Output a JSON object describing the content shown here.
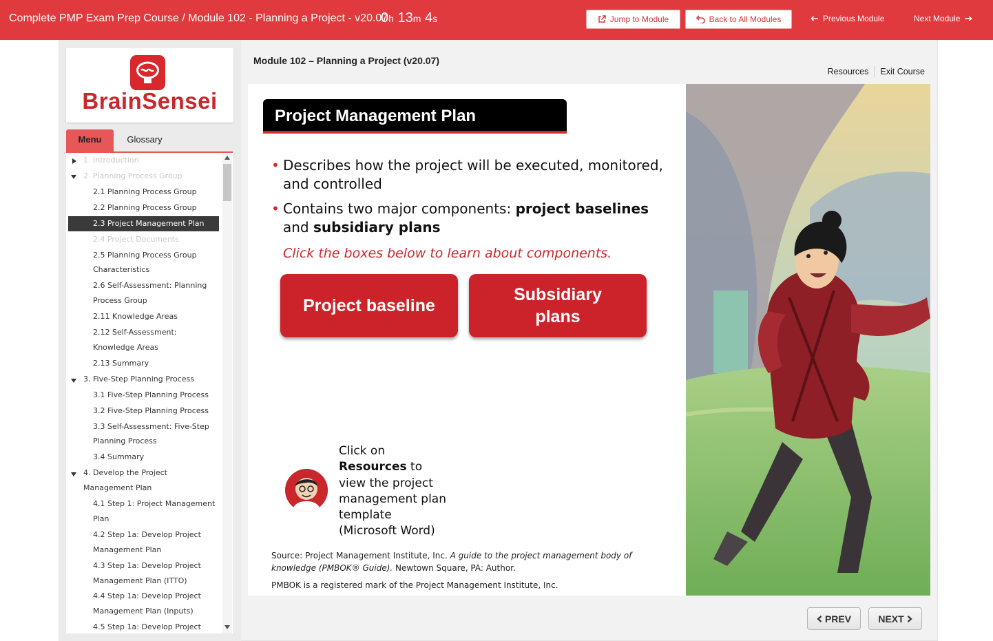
{
  "topbar": {
    "course_title": "Complete PMP Exam Prep Course / Module 102 - Planning a Project - v20.07",
    "timer": {
      "h": "0",
      "h_unit": "h",
      "m": "13",
      "m_unit": "m",
      "s": "4",
      "s_unit": "s"
    },
    "jump_label": "Jump to Module",
    "back_label": "Back to All Modules",
    "prev_module_label": "Previous Module",
    "next_module_label": "Next Module"
  },
  "brand": {
    "logo_text": "BrainSensei"
  },
  "tabs": {
    "menu": "Menu",
    "glossary": "Glossary"
  },
  "menu_items": [
    {
      "label": "1. Introduction"
    },
    {
      "label": "2. Planning Process Group"
    },
    {
      "label": "2.1 Planning Process Group"
    },
    {
      "label": "2.2 Planning Process Group"
    },
    {
      "label": "2.3 Project Management Plan"
    },
    {
      "label": "2.4 Project Documents"
    },
    {
      "label": "2.5 Planning Process Group",
      "label2": "Characteristics"
    },
    {
      "label": "2.6 Self-Assessment: Planning",
      "label2": "Process Group"
    },
    {
      "label": "2.11 Knowledge Areas"
    },
    {
      "label": "2.12 Self-Assessment:",
      "label2": "Knowledge Areas"
    },
    {
      "label": "2.13 Summary"
    },
    {
      "label": "3. Five-Step Planning Process"
    },
    {
      "label": "3.1 Five-Step Planning Process"
    },
    {
      "label": "3.2 Five-Step Planning Process"
    },
    {
      "label": "3.3 Self-Assessment: Five-Step",
      "label2": "Planning Process"
    },
    {
      "label": "3.4 Summary"
    },
    {
      "label": "4. Develop the Project",
      "label2": "Management Plan"
    },
    {
      "label": "4.1 Step 1: Project Management",
      "label2": "Plan"
    },
    {
      "label": "4.2 Step 1a: Develop Project",
      "label2": "Management Plan"
    },
    {
      "label": "4.3 Step 1a: Develop Project",
      "label2": "Management Plan (ITTO)"
    },
    {
      "label": "4.4 Step 1a: Develop Project",
      "label2": "Management Plan (Inputs)"
    },
    {
      "label": "4.5 Step 1a: Develop Project"
    }
  ],
  "header": {
    "module_title": "Module 102 – Planning a Project (v20.07)",
    "resources": "Resources",
    "exit": "Exit Course"
  },
  "slide": {
    "title": "Project Management Plan",
    "bullet1": "Describes how the project will be executed, monitored, and controlled",
    "bullet2_pre": "Contains two major components: ",
    "bullet2_b1": "project baselines",
    "bullet2_mid": " and ",
    "bullet2_b2": "subsidiary plans",
    "instruction": "Click the boxes below to learn about components.",
    "btn_baseline": "Project baseline",
    "btn_subsidiary": "Subsidiary plans",
    "tip_pre": "Click on ",
    "tip_bold": "Resources",
    "tip_post": " to view the project management plan template (Microsoft Word)",
    "source_pre": "Source: Project Management Institute, Inc. ",
    "source_italic": "A guide to the project management body of knowledge (PMBOK® Guide).",
    "source_post": " Newtown Square, PA: Author.",
    "pmbok_note": "PMBOK is a registered mark of the Project Management Institute, Inc."
  },
  "nav": {
    "prev": "PREV",
    "next": "NEXT"
  },
  "colors": {
    "brand_red": "#e03a3e",
    "button_red": "#cc2229",
    "active_item": "#3a3a3a"
  }
}
